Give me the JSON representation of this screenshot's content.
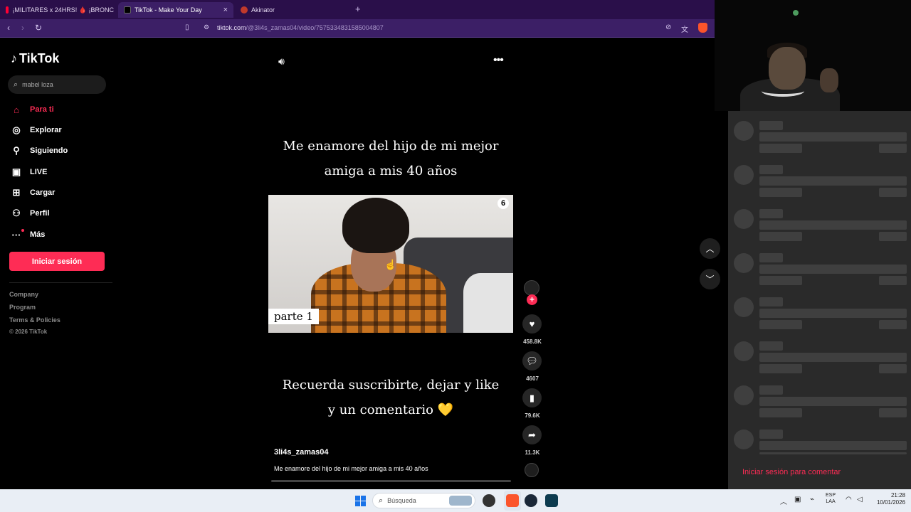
{
  "browser": {
    "tabs": [
      {
        "label": "¡MILITARES x 24HRS! 🩸 ¡BRONC",
        "active": false,
        "favicon_color": "#ff0033"
      },
      {
        "label": "TikTok - Make Your Day",
        "active": true,
        "favicon_color": "#000000"
      },
      {
        "label": "Akinator",
        "active": false,
        "favicon_color": "#c0392b"
      }
    ],
    "new_tab": "+",
    "close": "×",
    "url_host": "tiktok.com",
    "url_path": "/@3li4s_zamas04/video/7575334831585004807"
  },
  "tiktok": {
    "logo_text": "TikTok",
    "search": {
      "value": "mabel loza"
    },
    "menu": [
      {
        "label": "Para ti",
        "icon": "home-icon",
        "active": true
      },
      {
        "label": "Explorar",
        "icon": "compass-icon",
        "active": false
      },
      {
        "label": "Siguiendo",
        "icon": "following-icon",
        "active": false
      },
      {
        "label": "LIVE",
        "icon": "live-icon",
        "active": false
      },
      {
        "label": "Cargar",
        "icon": "upload-icon",
        "active": false
      },
      {
        "label": "Perfil",
        "icon": "profile-icon",
        "active": false
      },
      {
        "label": "Más",
        "icon": "more-icon",
        "active": false
      }
    ],
    "login_button": "Iniciar sesión",
    "footer": {
      "links": [
        "Company",
        "Program",
        "Terms & Policies"
      ],
      "copyright": "© 2026 TikTok"
    }
  },
  "video": {
    "caption_top_line1": "Me enamore del hijo de mi mejor",
    "caption_top_line2": "amiga a mis 40 años",
    "overlay_label": "parte 1",
    "channel_logo": "6",
    "caption_bottom_line1": "Recuerda suscribirte, dejar y like",
    "caption_bottom_line2": "y un comentario 💛",
    "author": "3li4s_zamas04",
    "description": "Me enamore del hijo de mi mejor amiga a mis 40 años",
    "progress": 0.0
  },
  "actions": {
    "likes": "458.8K",
    "comments": "4607",
    "saves": "79.6K",
    "shares": "11.3K"
  },
  "comments_panel": {
    "login_prompt": "Iniciar sesión para comentar"
  },
  "taskbar": {
    "search_placeholder": "Búsqueda",
    "lang_line1": "ESP",
    "lang_line2": "LAA",
    "time": "21:28",
    "date": "10/01/2026"
  }
}
